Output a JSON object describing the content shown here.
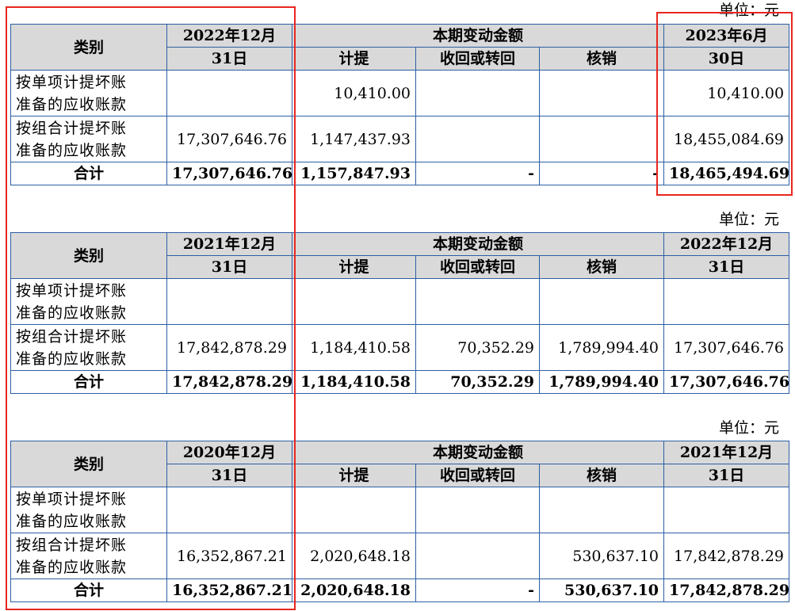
{
  "tables": [
    {
      "unit": "单位：元",
      "header": {
        "category": "类别",
        "start_line1": "2022年12月",
        "start_line2": "31日",
        "change_group": "本期变动金额",
        "provision": "计提",
        "recovery": "收回或转回",
        "writeoff": "核销",
        "end_line1": "2023年6月",
        "end_line2": "30日"
      },
      "rows": [
        {
          "label_line1": "按单项计提坏账",
          "label_line2": "准备的应收账款",
          "start": "",
          "provision": "10,410.00",
          "recovery": "",
          "writeoff": "",
          "end": "10,410.00"
        },
        {
          "label_line1": "按组合计提坏账",
          "label_line2": "准备的应收账款",
          "start": "17,307,646.76",
          "provision": "1,147,437.93",
          "recovery": "",
          "writeoff": "",
          "end": "18,455,084.69"
        }
      ],
      "total": {
        "label": "合计",
        "start": "17,307,646.76",
        "provision": "1,157,847.93",
        "recovery": "-",
        "writeoff": "-",
        "end": "18,465,494.69"
      }
    },
    {
      "unit": "单位：元",
      "header": {
        "category": "类别",
        "start_line1": "2021年12月",
        "start_line2": "31日",
        "change_group": "本期变动金额",
        "provision": "计提",
        "recovery": "收回或转回",
        "writeoff": "核销",
        "end_line1": "2022年12月",
        "end_line2": "31日"
      },
      "rows": [
        {
          "label_line1": "按单项计提坏账",
          "label_line2": "准备的应收账款",
          "start": "",
          "provision": "",
          "recovery": "",
          "writeoff": "",
          "end": ""
        },
        {
          "label_line1": "按组合计提坏账",
          "label_line2": "准备的应收账款",
          "start": "17,842,878.29",
          "provision": "1,184,410.58",
          "recovery": "70,352.29",
          "writeoff": "1,789,994.40",
          "end": "17,307,646.76"
        }
      ],
      "total": {
        "label": "合计",
        "start": "17,842,878.29",
        "provision": "1,184,410.58",
        "recovery": "70,352.29",
        "writeoff": "1,789,994.40",
        "end": "17,307,646.76"
      }
    },
    {
      "unit": "单位：元",
      "header": {
        "category": "类别",
        "start_line1": "2020年12月",
        "start_line2": "31日",
        "change_group": "本期变动金额",
        "provision": "计提",
        "recovery": "收回或转回",
        "writeoff": "核销",
        "end_line1": "2021年12月",
        "end_line2": "31日"
      },
      "rows": [
        {
          "label_line1": "按单项计提坏账",
          "label_line2": "准备的应收账款",
          "start": "",
          "provision": "",
          "recovery": "",
          "writeoff": "",
          "end": ""
        },
        {
          "label_line1": "按组合计提坏账",
          "label_line2": "准备的应收账款",
          "start": "16,352,867.21",
          "provision": "2,020,648.18",
          "recovery": "",
          "writeoff": "530,637.10",
          "end": "17,842,878.29"
        }
      ],
      "total": {
        "label": "合计",
        "start": "16,352,867.21",
        "provision": "2,020,648.18",
        "recovery": "-",
        "writeoff": "530,637.10",
        "end": "17,842,878.29"
      }
    }
  ],
  "colors": {
    "border": "#2c5fa3",
    "header_bg": "#d9d9d9",
    "highlight": "#e8261f"
  }
}
